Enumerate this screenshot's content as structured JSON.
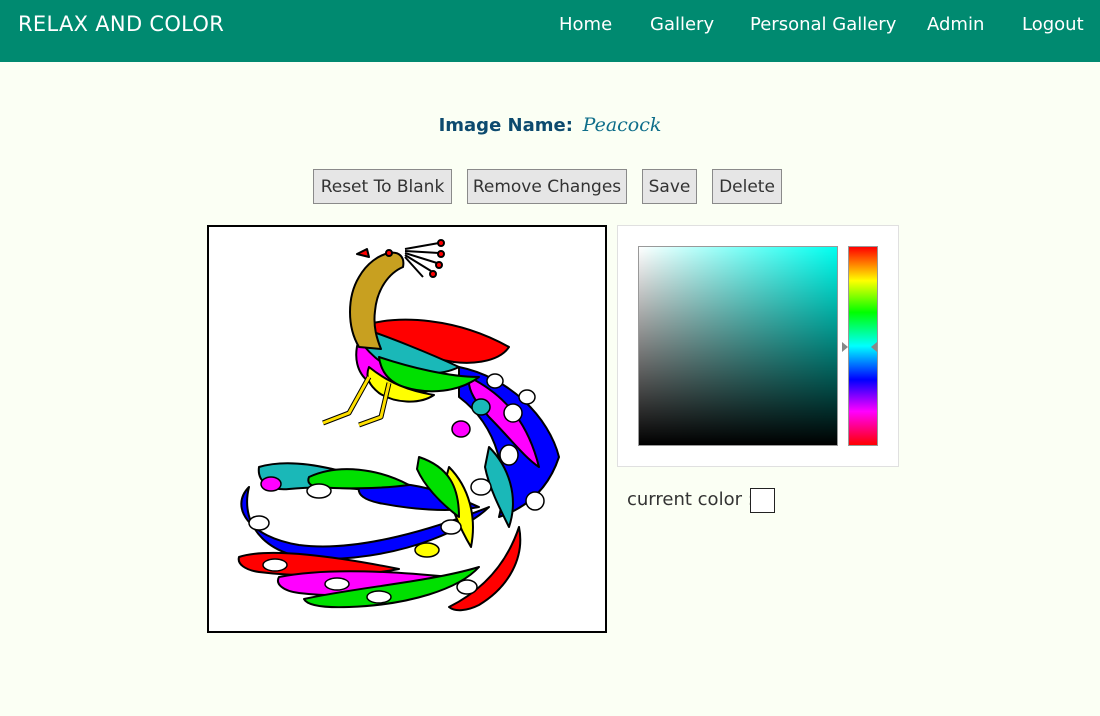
{
  "navbar": {
    "brand": "RELAX AND COLOR",
    "links": [
      "Home",
      "Gallery",
      "Personal Gallery",
      "Admin",
      "Logout"
    ],
    "background": "#008a70"
  },
  "image": {
    "name_label": "Image Name:",
    "name_value": "Peacock"
  },
  "toolbar": {
    "reset_label": "Reset To Blank",
    "remove_label": "Remove Changes",
    "save_label": "Save",
    "delete_label": "Delete"
  },
  "canvas": {
    "subject": "peacock coloring page",
    "palette": [
      "#c8a020",
      "#ff0000",
      "#1ab8b8",
      "#0000ff",
      "#00e000",
      "#ff00ff",
      "#ffff00"
    ]
  },
  "color_picker": {
    "hue_color": "#00fff0",
    "current_color_label": "current color :",
    "current_color": "#ffffff"
  }
}
